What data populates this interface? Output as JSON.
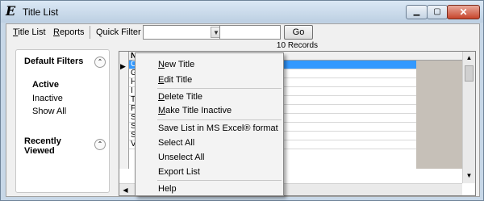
{
  "window": {
    "title": "Title List"
  },
  "menubar": {
    "items": [
      {
        "label_accel": "T",
        "label_rest": "itle List"
      },
      {
        "label_accel": "R",
        "label_rest": "eports"
      }
    ],
    "quick_filter_label": "Quick Filter",
    "go_label": "Go"
  },
  "filters": {
    "default_header": "Default Filters",
    "options": [
      "Active",
      "Inactive",
      "Show All"
    ],
    "recently_viewed_header_line1": "Recently",
    "recently_viewed_header_line2": "Viewed"
  },
  "grid": {
    "records_text": "10 Records",
    "column_header": "Name",
    "row_initials": [
      "C",
      "G",
      "H",
      "I",
      "T",
      "F",
      "S",
      "S",
      "S",
      "V"
    ]
  },
  "context_menu": {
    "items": [
      {
        "accel": "N",
        "rest": "ew Title"
      },
      {
        "accel": "E",
        "rest": "dit Title"
      },
      {
        "accel": "D",
        "rest": "elete Title"
      },
      {
        "accel": "M",
        "rest": "ake Title Inactive"
      },
      {
        "accel": "",
        "rest": "Save List in MS Excel® format"
      },
      {
        "accel": "",
        "rest": "Select All"
      },
      {
        "accel": "",
        "rest": "Unselect All"
      },
      {
        "accel": "",
        "rest": "Export List"
      },
      {
        "accel": "",
        "rest": "Help"
      }
    ]
  },
  "colors": {
    "selection": "#3399ff",
    "titlebar": "#c7d7e7"
  }
}
